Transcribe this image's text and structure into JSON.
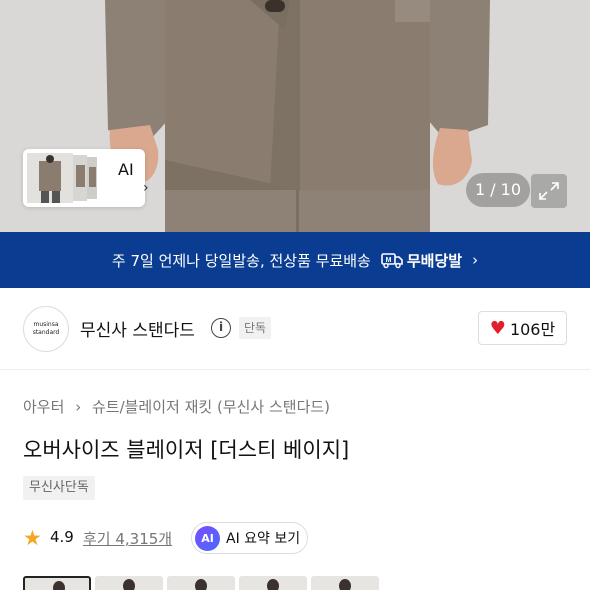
{
  "gallery": {
    "counter": "1 / 10",
    "ai_label": "AI",
    "ai_chevron": "›"
  },
  "shipping_banner": {
    "text": "주 7일 언제나 당일발송, 전상품 무료배송",
    "brand_label": "무배당발",
    "chevron": "›"
  },
  "brand": {
    "logo_line1": "musinsa",
    "logo_line2": "standard",
    "name": "무신사 스탠다드",
    "tag": "단독",
    "like_count": "106만"
  },
  "product": {
    "breadcrumb": [
      "아우터",
      "›",
      "슈트/블레이저 재킷 (무신사 스탠다드)"
    ],
    "title": "오버사이즈 블레이저 [더스티 베이지]",
    "tag": "무신사단독",
    "rating": "4.9",
    "reviews": "후기 4,315개",
    "ai_badge": "AI",
    "ai_summary": "AI 요약 보기"
  },
  "colors": {
    "accent_blue": "#0a3d91",
    "heart_red": "#e41d2a",
    "star_orange": "#f5a623",
    "jacket_taupe": "#8a7d6f"
  }
}
